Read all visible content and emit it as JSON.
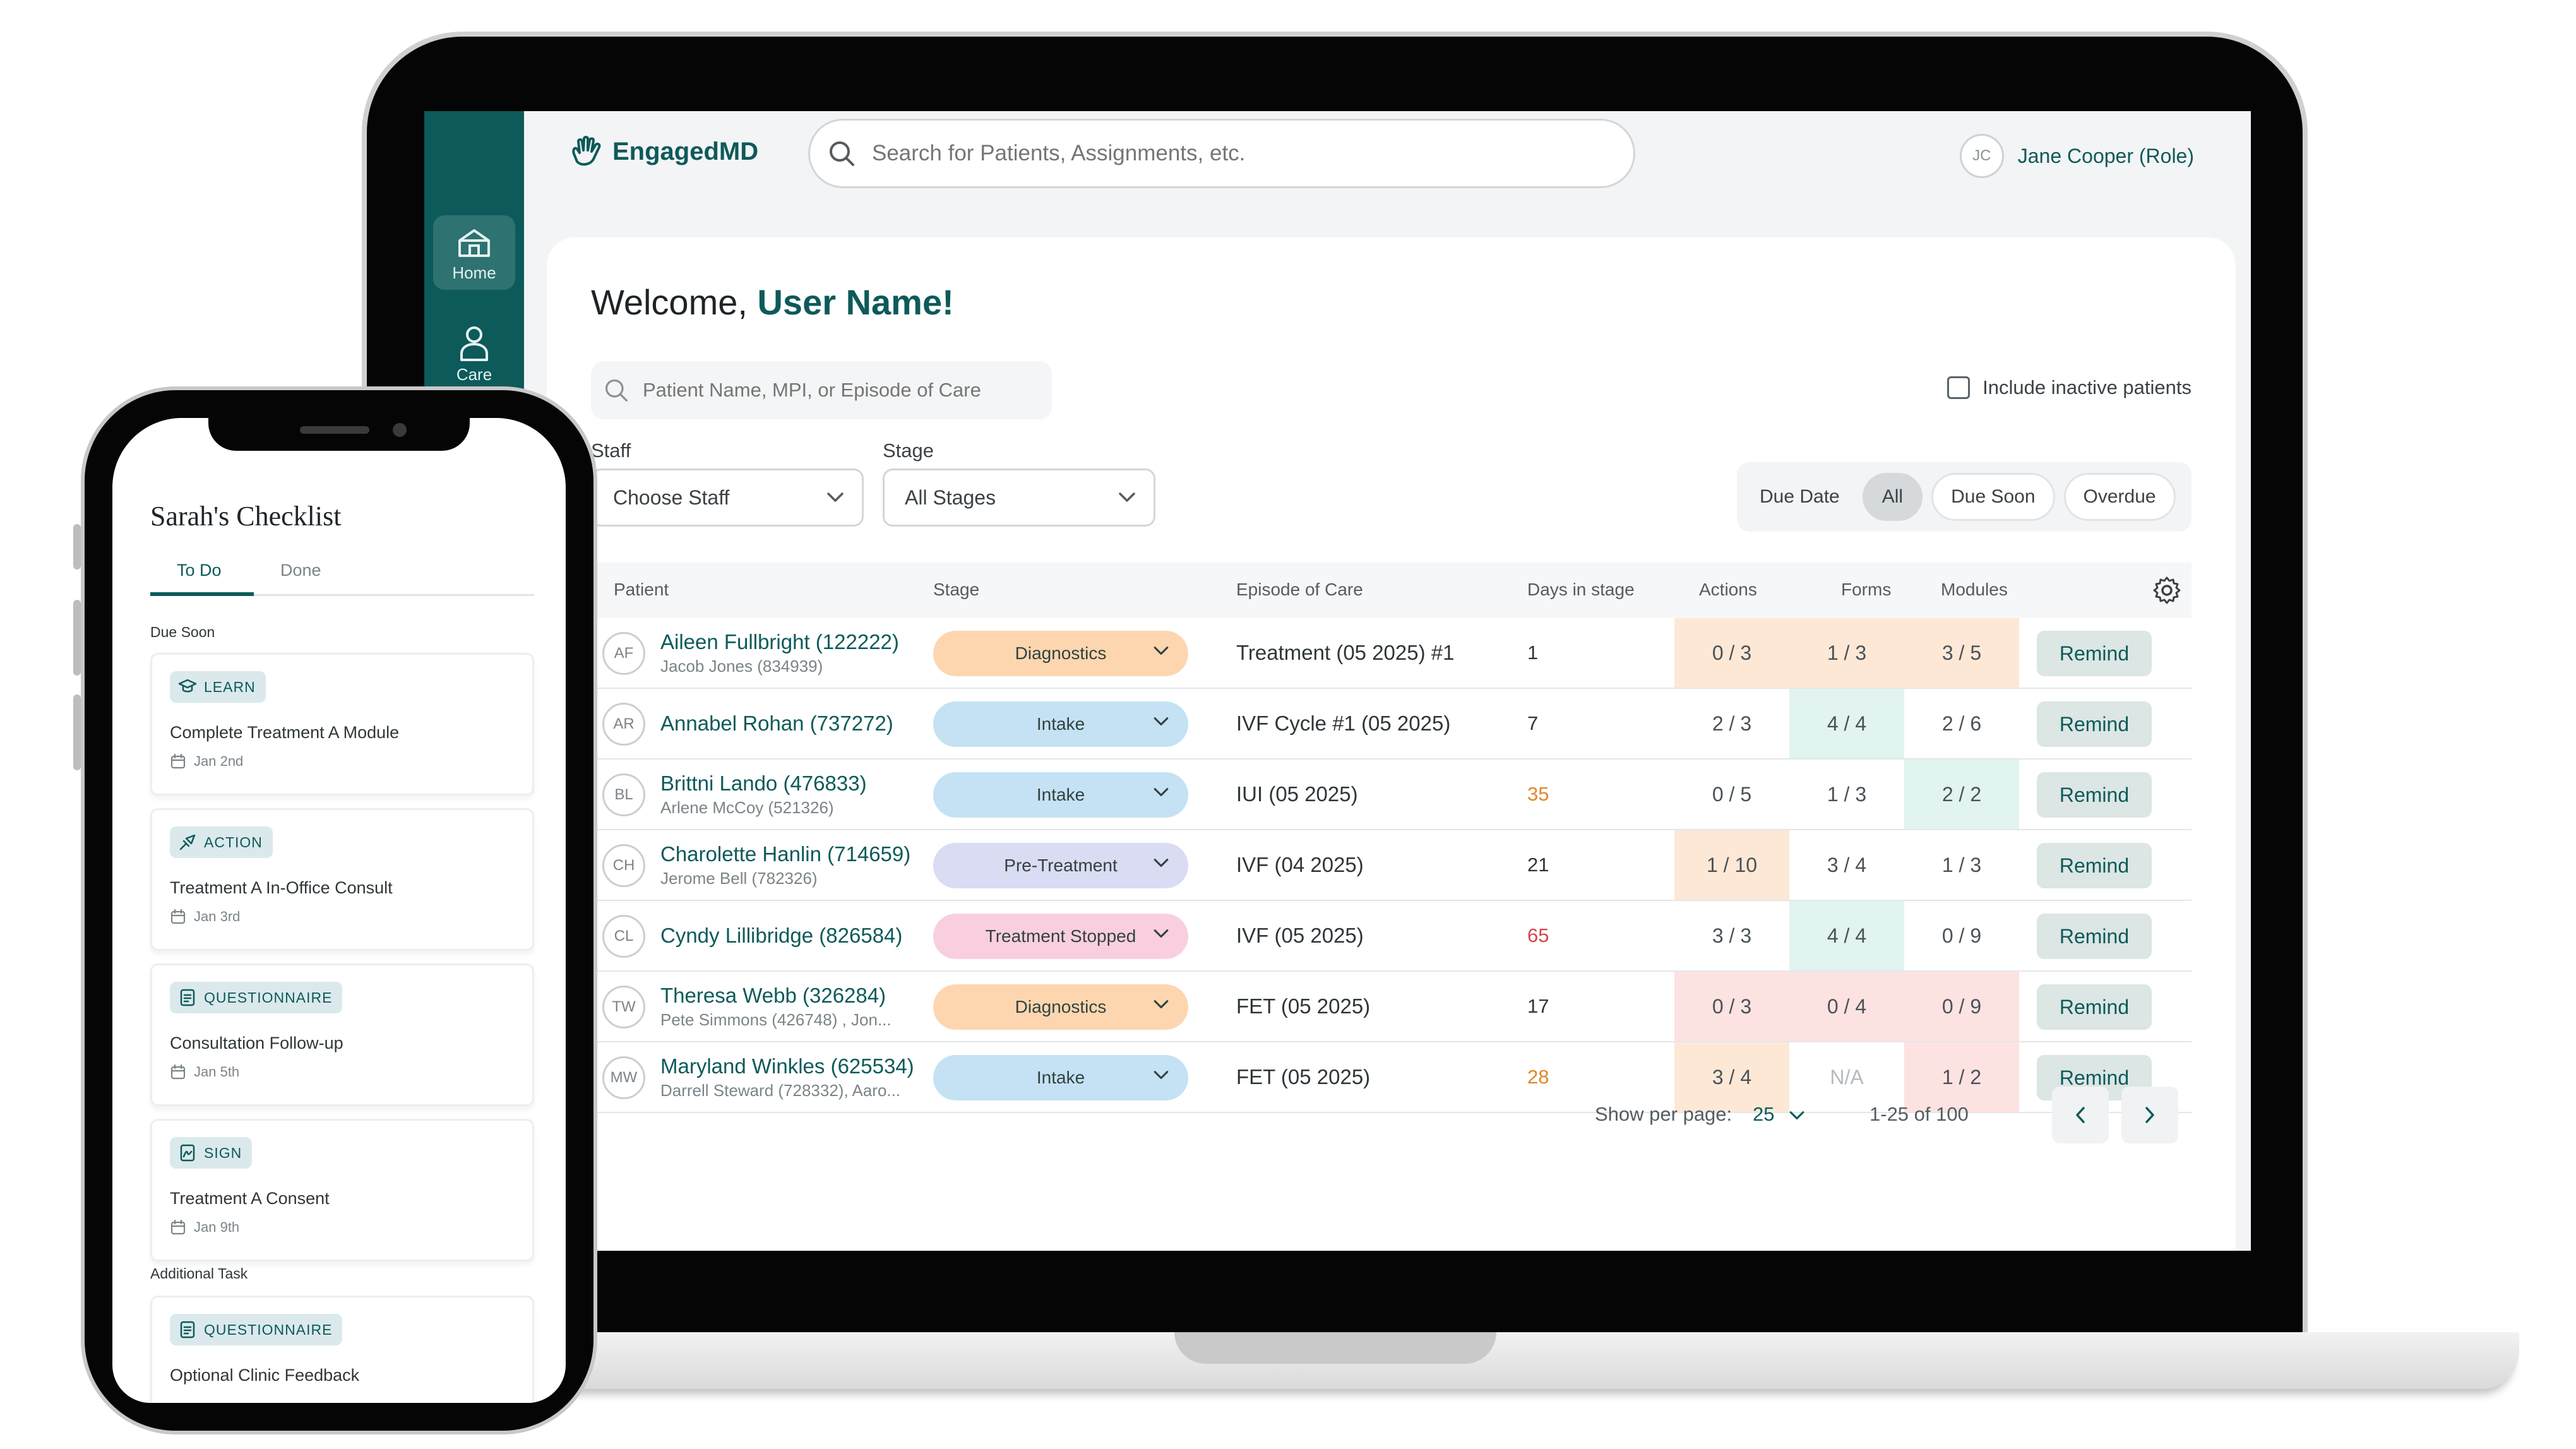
{
  "app": {
    "logo_text": "EngagedMD",
    "search_placeholder": "Search for Patients, Assignments, etc.",
    "user_initials": "JC",
    "user_name": "Jane Cooper (Role)"
  },
  "sidebar": {
    "items": [
      {
        "label": "Home",
        "icon": "home-icon"
      },
      {
        "label": "Care",
        "icon": "person-icon"
      }
    ]
  },
  "dashboard": {
    "welcome_prefix": "Welcome, ",
    "welcome_name": "User Name!",
    "patient_search_placeholder": "Patient Name, MPI, or Episode of Care",
    "include_inactive_label": "Include inactive patients",
    "staff_label": "Staff",
    "staff_value": "Choose Staff",
    "stage_label": "Stage",
    "stage_value": "All Stages",
    "due_label": "Due Date",
    "due_options": [
      "All",
      "Due Soon",
      "Overdue"
    ],
    "due_selected": "All"
  },
  "table": {
    "columns": [
      "Patient",
      "Stage",
      "Episode of Care",
      "Days in stage",
      "Actions",
      "Forms",
      "Modules"
    ],
    "remind_label": "Remind",
    "rows": [
      {
        "initials": "AF",
        "name": "Aileen Fullbright (122222)",
        "sub": "Jacob Jones (834939)",
        "stage": "Diagnostics",
        "stage_color": "#fdd6b0",
        "episode": "Treatment (05 2025) #1",
        "days": "1",
        "days_color": "#2f3639",
        "actions": "0 / 3",
        "actions_bg": "#fde8d6",
        "forms": "1 / 3",
        "forms_bg": "#fde8d6",
        "modules": "3 / 5",
        "modules_bg": "#fde8d6"
      },
      {
        "initials": "AR",
        "name": "Annabel Rohan (737272)",
        "sub": "",
        "stage": "Intake",
        "stage_color": "#c4e2f4",
        "episode": "IVF Cycle #1 (05 2025)",
        "days": "7",
        "days_color": "#2f3639",
        "actions": "2 / 3",
        "actions_bg": "#ffffff",
        "forms": "4 / 4",
        "forms_bg": "#e1f4ef",
        "modules": "2 / 6",
        "modules_bg": "#ffffff"
      },
      {
        "initials": "BL",
        "name": "Brittni Lando (476833)",
        "sub": "Arlene McCoy (521326)",
        "stage": "Intake",
        "stage_color": "#c4e2f4",
        "episode": "IUI (05 2025)",
        "days": "35",
        "days_color": "#e0862c",
        "actions": "0 / 5",
        "actions_bg": "#ffffff",
        "forms": "1 / 3",
        "forms_bg": "#ffffff",
        "modules": "2 / 2",
        "modules_bg": "#e1f4ef"
      },
      {
        "initials": "CH",
        "name": "Charolette Hanlin (714659)",
        "sub": "Jerome Bell  (782326)",
        "stage": "Pre-Treatment",
        "stage_color": "#d9dcf2",
        "episode": "IVF (04 2025)",
        "days": "21",
        "days_color": "#2f3639",
        "actions": "1 / 10",
        "actions_bg": "#fde8d6",
        "forms": "3 / 4",
        "forms_bg": "#ffffff",
        "modules": "1 / 3",
        "modules_bg": "#ffffff"
      },
      {
        "initials": "CL",
        "name": "Cyndy Lillibridge (826584)",
        "sub": "",
        "stage": "Treatment Stopped",
        "stage_color": "#f9cfe0",
        "episode": "IVF (05 2025)",
        "days": "65",
        "days_color": "#d6464b",
        "actions": "3 / 3",
        "actions_bg": "#ffffff",
        "forms": "4 / 4",
        "forms_bg": "#e1f4ef",
        "modules": "0 / 9",
        "modules_bg": "#ffffff"
      },
      {
        "initials": "TW",
        "name": "Theresa Webb (326284)",
        "sub": "Pete Simmons (426748) , Jon...",
        "stage": "Diagnostics",
        "stage_color": "#fdd6b0",
        "episode": "FET (05 2025)",
        "days": "17",
        "days_color": "#2f3639",
        "actions": "0 / 3",
        "actions_bg": "#fde2e2",
        "forms": "0 / 4",
        "forms_bg": "#fde2e2",
        "modules": "0 / 9",
        "modules_bg": "#fde2e2"
      },
      {
        "initials": "MW",
        "name": "Maryland Winkles (625534)",
        "sub": "Darrell Steward (728332), Aaro...",
        "stage": "Intake",
        "stage_color": "#c4e2f4",
        "episode": "FET (05 2025)",
        "days": "28",
        "days_color": "#e0862c",
        "actions": "3 / 4",
        "actions_bg": "#fde8d6",
        "forms": "N/A",
        "forms_bg": "#ffffff",
        "modules": "1 / 2",
        "modules_bg": "#fde2e2"
      }
    ]
  },
  "pagination": {
    "show_per_page_label": "Show per page:",
    "per_page": "25",
    "range": "1-25 of 100"
  },
  "phone": {
    "title": "Sarah's Checklist",
    "tabs": [
      "To Do",
      "Done"
    ],
    "section_due_soon": "Due Soon",
    "section_additional": "Additional Task",
    "tasks": [
      {
        "badge": "LEARN",
        "icon": "graduation-cap-icon",
        "title": "Complete Treatment A Module",
        "date": "Jan 2nd"
      },
      {
        "badge": "ACTION",
        "icon": "action-icon",
        "title": "Treatment A In-Office Consult",
        "date": "Jan 3rd"
      },
      {
        "badge": "QUESTIONNAIRE",
        "icon": "document-icon",
        "title": "Consultation Follow-up",
        "date": "Jan 5th"
      },
      {
        "badge": "SIGN",
        "icon": "signature-icon",
        "title": "Treatment A Consent",
        "date": "Jan 9th"
      }
    ],
    "additional_tasks": [
      {
        "badge": "QUESTIONNAIRE",
        "icon": "document-icon",
        "title": "Optional Clinic Feedback"
      }
    ]
  }
}
